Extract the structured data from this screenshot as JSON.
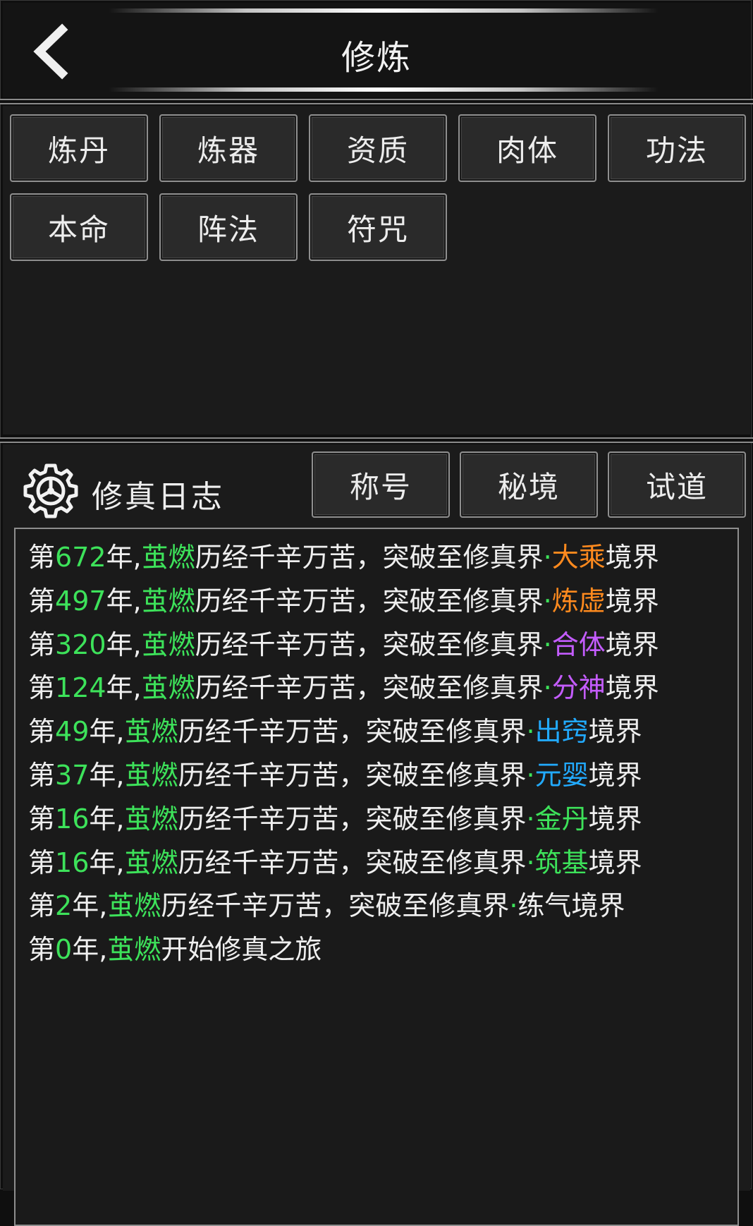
{
  "header": {
    "title": "修炼",
    "back_icon": "chevron-left-icon"
  },
  "cultivation_tabs": [
    {
      "label": "炼丹"
    },
    {
      "label": "炼器"
    },
    {
      "label": "资质"
    },
    {
      "label": "肉体"
    },
    {
      "label": "功法"
    },
    {
      "label": "本命"
    },
    {
      "label": "阵法"
    },
    {
      "label": "符咒"
    }
  ],
  "log": {
    "icon": "gear-icon",
    "title": "修真日志",
    "buttons": [
      {
        "label": "称号"
      },
      {
        "label": "秘境"
      },
      {
        "label": "试道"
      }
    ],
    "entries": [
      {
        "prefix": "第",
        "year": "672",
        "mid": "年,",
        "name": "茧燃",
        "text": "历经千辛万苦，突破至修真界",
        "dot": "·",
        "realm": "大乘",
        "realm_color": "#ff8a1e",
        "suffix": "境界"
      },
      {
        "prefix": "第",
        "year": "497",
        "mid": "年,",
        "name": "茧燃",
        "text": "历经千辛万苦，突破至修真界",
        "dot": "·",
        "realm": "炼虚",
        "realm_color": "#ff8a1e",
        "suffix": "境界"
      },
      {
        "prefix": "第",
        "year": "320",
        "mid": "年,",
        "name": "茧燃",
        "text": "历经千辛万苦，突破至修真界",
        "dot": "·",
        "realm": "合体",
        "realm_color": "#c45cff",
        "suffix": "境界"
      },
      {
        "prefix": "第",
        "year": "124",
        "mid": "年,",
        "name": "茧燃",
        "text": "历经千辛万苦，突破至修真界",
        "dot": "·",
        "realm": "分神",
        "realm_color": "#c45cff",
        "suffix": "境界"
      },
      {
        "prefix": "第",
        "year": "49",
        "mid": "年,",
        "name": "茧燃",
        "text": "历经千辛万苦，突破至修真界",
        "dot": "·",
        "realm": "出窍",
        "realm_color": "#22aaff",
        "suffix": "境界"
      },
      {
        "prefix": "第",
        "year": "37",
        "mid": "年,",
        "name": "茧燃",
        "text": "历经千辛万苦，突破至修真界",
        "dot": "·",
        "realm": "元婴",
        "realm_color": "#22aaff",
        "suffix": "境界"
      },
      {
        "prefix": "第",
        "year": "16",
        "mid": "年,",
        "name": "茧燃",
        "text": "历经千辛万苦，突破至修真界",
        "dot": "·",
        "realm": "金丹",
        "realm_color": "#3de25a",
        "suffix": "境界"
      },
      {
        "prefix": "第",
        "year": "16",
        "mid": "年,",
        "name": "茧燃",
        "text": "历经千辛万苦，突破至修真界",
        "dot": "·",
        "realm": "筑基",
        "realm_color": "#3de25a",
        "suffix": "境界"
      },
      {
        "prefix": "第",
        "year": "2",
        "mid": "年,",
        "name": "茧燃",
        "text": "历经千辛万苦，突破至修真界",
        "dot": "·",
        "realm": "练气",
        "realm_color": "#efefef",
        "suffix": "境界"
      },
      {
        "prefix": "第",
        "year": "0",
        "mid": "年,",
        "name": "茧燃",
        "text": "开始修真之旅",
        "dot": "",
        "realm": "",
        "realm_color": "#efefef",
        "suffix": ""
      }
    ]
  }
}
